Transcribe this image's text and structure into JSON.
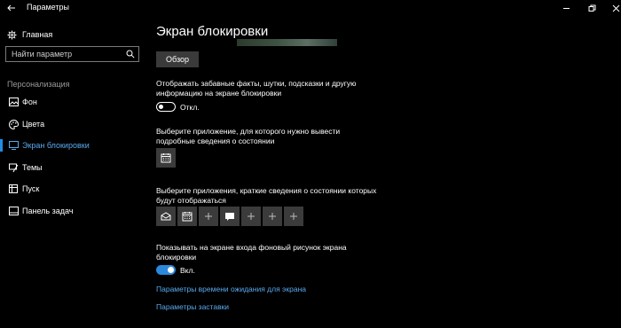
{
  "window": {
    "title": "Параметры"
  },
  "sidebar": {
    "home_label": "Главная",
    "search_placeholder": "Найти параметр",
    "section_title": "Персонализация",
    "items": [
      {
        "label": "Фон",
        "icon": "picture-icon"
      },
      {
        "label": "Цвета",
        "icon": "palette-icon"
      },
      {
        "label": "Экран блокировки",
        "icon": "lock-screen-icon",
        "active": true
      },
      {
        "label": "Темы",
        "icon": "brush-icon"
      },
      {
        "label": "Пуск",
        "icon": "start-icon"
      },
      {
        "label": "Панель задач",
        "icon": "taskbar-icon"
      }
    ]
  },
  "main": {
    "title": "Экран блокировки",
    "browse_label": "Обзор",
    "fun_facts": {
      "line1": "Отображать забавные факты, шутки, подсказки и другую",
      "line2": "информацию на экране блокировки",
      "state": "Откл."
    },
    "detailed_status": {
      "line1": "Выберите приложение, для которого нужно вывести",
      "line2": "подробные сведения о состоянии"
    },
    "quick_status": {
      "line1": "Выберите приложения, краткие сведения о состоянии которых",
      "line2": "будут отображаться",
      "tiles": [
        "mail-icon",
        "calendar-icon",
        "plus-icon",
        "chat-icon",
        "plus-icon",
        "plus-icon",
        "plus-icon"
      ]
    },
    "signin_background": {
      "line1": "Показывать на экране входа фоновый рисунок экрана",
      "line2": "блокировки",
      "state": "Вкл."
    },
    "links": {
      "timeout": "Параметры времени ожидания для экрана",
      "screensaver": "Параметры заставки"
    }
  },
  "colors": {
    "accent": "#1f8fe5",
    "link": "#5aa9ee",
    "background": "#000000",
    "tile": "#3b3b3b"
  }
}
